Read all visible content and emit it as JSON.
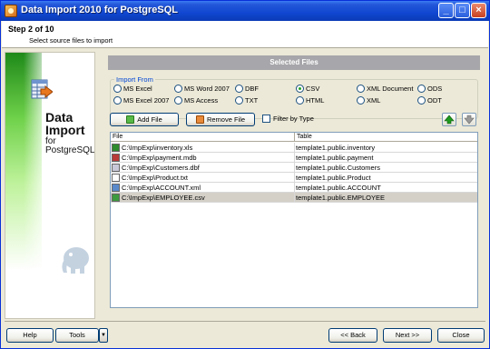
{
  "window": {
    "title": "Data Import 2010 for PostgreSQL"
  },
  "header": {
    "step": "Step 2 of 10",
    "subtitle": "Select source files to import"
  },
  "banner": {
    "product_line1": "Data",
    "product_line2": "Import",
    "for_text": "for",
    "platform": "PostgreSQL"
  },
  "section": {
    "title": "Selected Files"
  },
  "import_from": {
    "legend": "Import From",
    "options": [
      "MS Excel",
      "MS Word 2007",
      "DBF",
      "CSV",
      "XML Document",
      "ODS",
      "MS Excel 2007",
      "MS Access",
      "TXT",
      "HTML",
      "XML",
      "ODT"
    ],
    "selected": "CSV"
  },
  "actions": {
    "add_file": "Add File",
    "remove_file": "Remove File",
    "filter_by_type": "Filter by Type"
  },
  "grid": {
    "columns": [
      "File",
      "Table"
    ],
    "rows": [
      {
        "file": "C:\\ImpExp\\inventory.xls",
        "table": "template1.public.inventory",
        "icon": "excel-file-icon"
      },
      {
        "file": "C:\\ImpExp\\payment.mdb",
        "table": "template1.public.payment",
        "icon": "access-file-icon"
      },
      {
        "file": "C:\\ImpExp\\Customers.dbf",
        "table": "template1.public.Customers",
        "icon": "dbf-file-icon"
      },
      {
        "file": "C:\\ImpExp\\Product.txt",
        "table": "template1.public.Product",
        "icon": "txt-file-icon"
      },
      {
        "file": "C:\\ImpExp\\ACCOUNT.xml",
        "table": "template1.public.ACCOUNT",
        "icon": "xml-file-icon"
      },
      {
        "file": "C:\\ImpExp\\EMPLOYEE.csv",
        "table": "template1.public.EMPLOYEE",
        "icon": "csv-file-icon"
      }
    ],
    "selected_row": 5
  },
  "footer": {
    "help": "Help",
    "tools": "Tools",
    "back": "<< Back",
    "next": "Next >>",
    "close": "Close"
  },
  "colors": {
    "title_bar": "#0a3bb5",
    "section_bar": "#a7a6aa",
    "banner_green": "#6fd14a",
    "selected_row": "#d4d0c8"
  }
}
